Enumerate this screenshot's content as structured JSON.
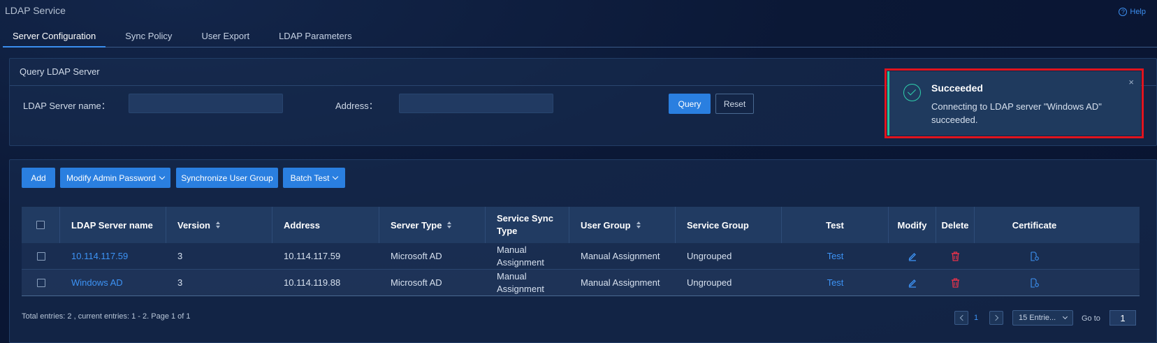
{
  "app": {
    "title": "LDAP Service",
    "help_label": "Help"
  },
  "tabs": [
    {
      "label": "Server Configuration",
      "active": true
    },
    {
      "label": "Sync Policy",
      "active": false
    },
    {
      "label": "User Export",
      "active": false
    },
    {
      "label": "LDAP Parameters",
      "active": false
    }
  ],
  "query": {
    "title": "Query LDAP Server",
    "name_label": "LDAP Server name：",
    "name_value": "",
    "address_label": "Address：",
    "address_value": "",
    "query_button": "Query",
    "reset_button": "Reset"
  },
  "toolbar": {
    "add": "Add",
    "modify_password": "Modify Admin Password",
    "sync_group": "Synchronize User Group",
    "batch_test": "Batch Test"
  },
  "table": {
    "headers": {
      "name": "LDAP Server name",
      "version": "Version",
      "address": "Address",
      "server_type": "Server Type",
      "sync_type": "Service Sync Type",
      "user_group": "User Group",
      "service_group": "Service Group",
      "test": "Test",
      "modify": "Modify",
      "delete": "Delete",
      "certificate": "Certificate"
    },
    "rows": [
      {
        "name": "10.114.117.59",
        "version": "3",
        "address": "10.114.117.59",
        "server_type": "Microsoft AD",
        "sync_type": "Manual Assignment",
        "user_group": "Manual Assignment",
        "service_group": "Ungrouped",
        "test": "Test"
      },
      {
        "name": "Windows AD",
        "version": "3",
        "address": "10.114.119.88",
        "server_type": "Microsoft AD",
        "sync_type": "Manual Assignment",
        "user_group": "Manual Assignment",
        "service_group": "Ungrouped",
        "test": "Test"
      }
    ]
  },
  "footer": {
    "summary": "Total entries: 2 , current entries: 1 - 2. Page 1 of 1",
    "page": "1",
    "entries_select": "15 Entrie...",
    "goto_label": "Go to",
    "goto_value": "1"
  },
  "toast": {
    "title": "Succeeded",
    "message": "Connecting to LDAP server \"Windows AD\" succeeded.",
    "close": "×"
  },
  "colors": {
    "accent": "#2a7fe0",
    "link": "#3d93f5",
    "success": "#2fd0ad",
    "danger": "#e8324a",
    "highlight": "#e0141e"
  }
}
